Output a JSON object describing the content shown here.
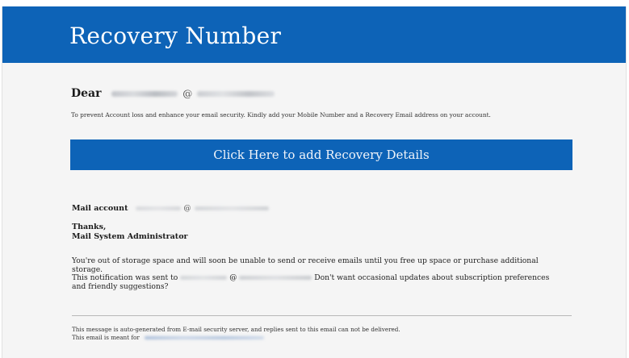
{
  "header": {
    "title": "Recovery Number"
  },
  "greeting": {
    "label": "Dear",
    "at": "@"
  },
  "intro": "To prevent Account loss and enhance your email security. Kindly add your Mobile Number and a Recovery Email address on your account.",
  "cta": {
    "label": "Click Here to add Recovery Details"
  },
  "mail_account": {
    "label": "Mail account",
    "at": "@"
  },
  "signoff": {
    "thanks": "Thanks,",
    "signature": "Mail System Administrator"
  },
  "body": {
    "storage_notice": "You're out of storage space and will soon be unable to send or receive emails until you free up space or purchase additional storage.",
    "sent_to_prefix": "This notification was sent to",
    "at": "@",
    "sent_to_suffix": "Don't want occasional updates about subscription preferences and friendly suggestions?"
  },
  "footer": {
    "auto_generated": "This message is auto-generated from E-mail security server, and replies sent to this email can not be delivered.",
    "meant_for": "This email is meant for"
  },
  "colors": {
    "brand_blue": "#0d63b7",
    "background": "#f5f5f5"
  }
}
